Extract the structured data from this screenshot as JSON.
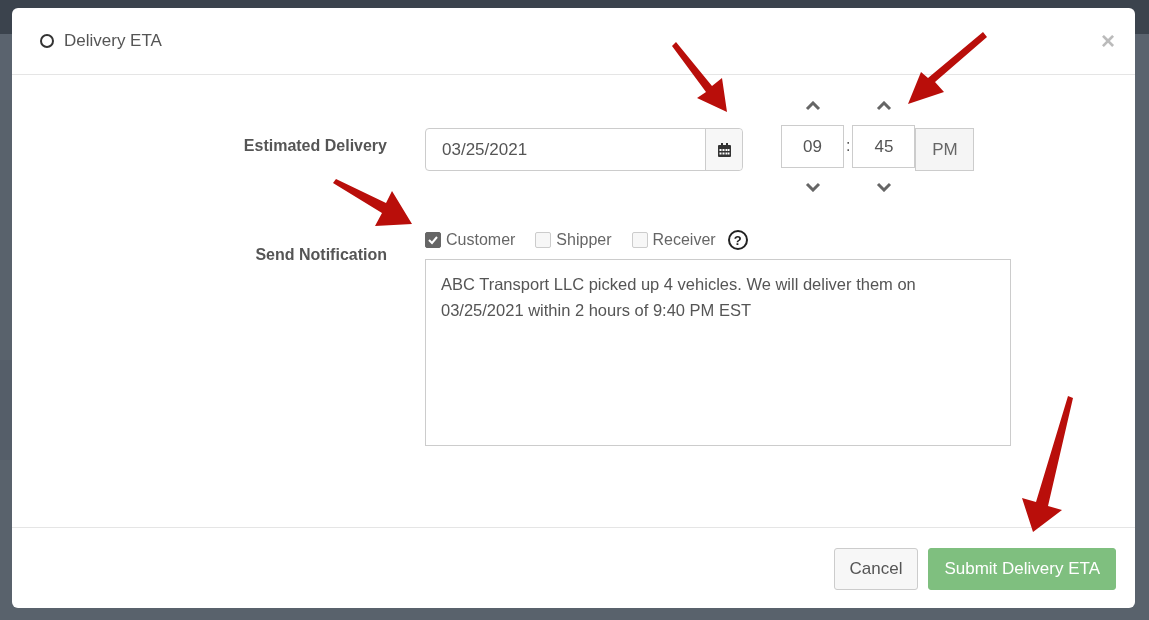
{
  "dialog": {
    "title": "Delivery ETA",
    "close": "×"
  },
  "estimated_delivery": {
    "label": "Estimated Delivery",
    "date": "03/25/2021",
    "hour": "09",
    "separator": ":",
    "minute": "45",
    "period": "PM"
  },
  "notification": {
    "label": "Send Notification",
    "recipients": [
      {
        "label": "Customer",
        "checked": true
      },
      {
        "label": "Shipper",
        "checked": false
      },
      {
        "label": "Receiver",
        "checked": false
      }
    ],
    "help": "?",
    "message": "ABC Transport LLC picked up 4 vehicles. We will deliver them on 03/25/2021 within 2 hours of 9:40 PM EST"
  },
  "buttons": [
    {
      "label": "Cancel",
      "kind": "default"
    },
    {
      "label": "Submit Delivery ETA",
      "kind": "primary"
    }
  ]
}
